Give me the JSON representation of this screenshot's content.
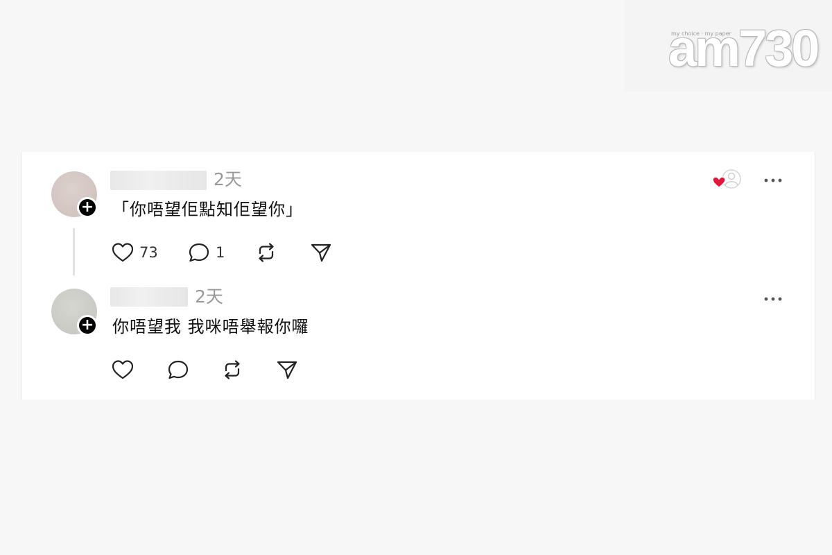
{
  "watermark": {
    "logo_text": "am730",
    "tagline": "my choice · my paper"
  },
  "posts": [
    {
      "time": "2天",
      "text": "「你唔望佢點知佢望你」",
      "likes": "73",
      "replies": "1",
      "liked_by_author": true
    },
    {
      "time": "2天",
      "text": "你唔望我 我咪唔舉報你囉",
      "likes": "",
      "replies": ""
    }
  ],
  "colors": {
    "background": "#f7f7f7",
    "card": "#ffffff",
    "heart_red": "#e0173b",
    "timestamp": "#999999"
  },
  "icons": [
    "heart-icon",
    "comment-icon",
    "repost-icon",
    "share-icon",
    "more-icon",
    "plus-icon"
  ]
}
